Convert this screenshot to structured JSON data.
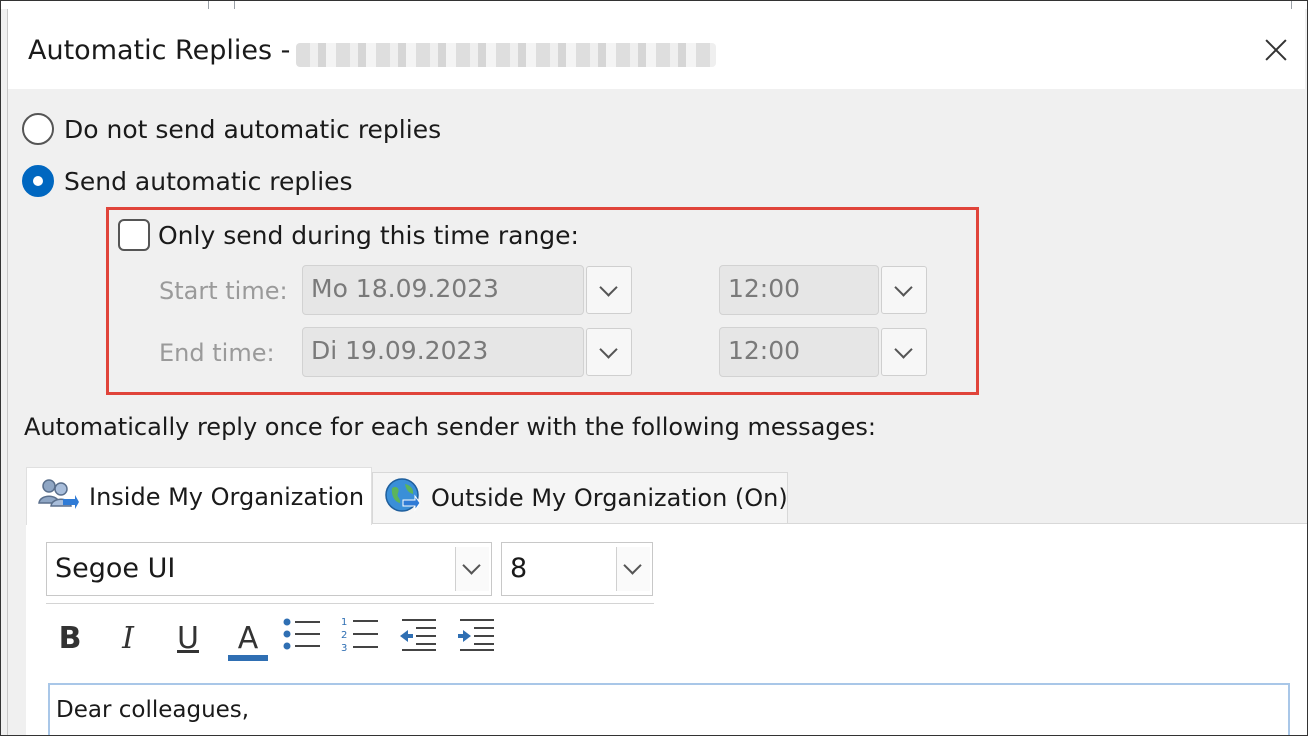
{
  "dialog": {
    "title": "Automatic Replies - "
  },
  "options": {
    "do_not_send_label": "Do not send automatic replies",
    "send_label": "Send automatic replies",
    "selected": "send"
  },
  "time_range": {
    "checkbox_label": "Only send during this time range:",
    "checked": false,
    "start_label": "Start time:",
    "start_date": "Mo 18.09.2023",
    "start_time": "12:00",
    "end_label": "End time:",
    "end_date": "Di 19.09.2023",
    "end_time": "12:00"
  },
  "messages": {
    "section_label": "Automatically reply once for each sender with the following messages:",
    "tabs": [
      {
        "label": "Inside My Organization",
        "icon": "people-icon",
        "active": true
      },
      {
        "label": "Outside My Organization (On)",
        "icon": "globe-icon",
        "active": false
      }
    ]
  },
  "format_toolbar": {
    "font_name": "Segoe UI",
    "font_size": "8",
    "bold_glyph": "B",
    "italic_glyph": "I",
    "underline_glyph": "U",
    "font_color_glyph": "A",
    "font_color": "#2f6fb3"
  },
  "editor": {
    "text": "Dear colleagues,"
  },
  "colors": {
    "accent": "#0067c0",
    "highlight_border": "#e0443a"
  }
}
